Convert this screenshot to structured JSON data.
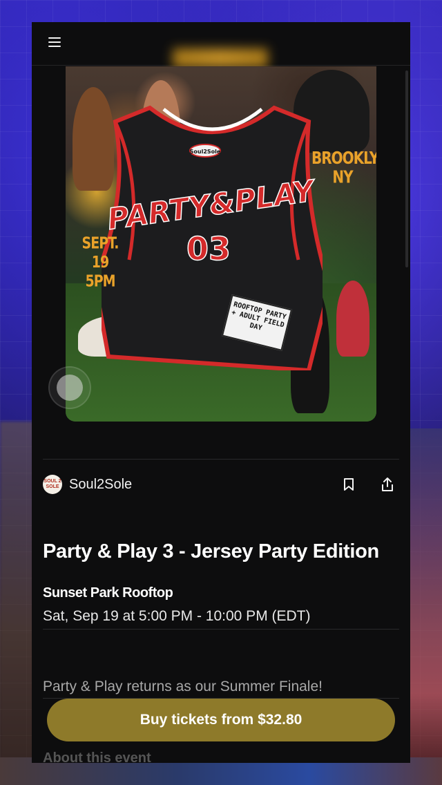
{
  "header": {
    "menu_icon": "hamburger-menu-icon"
  },
  "flyer": {
    "jersey_text": "PARTY&PLAY",
    "jersey_number": "03",
    "jersey_tag": "Soul2Sole",
    "brooklyn_text": "BROOKLYN, NY",
    "date_text": "SEPT. 19 5PM",
    "sign_text": "ROOFTOP PARTY + ADULT FIELD DAY"
  },
  "organizer": {
    "name": "Soul2Sole",
    "avatar_text": "SOUL 2 SOLE",
    "bookmark_icon": "bookmark-icon",
    "share_icon": "share-icon"
  },
  "event": {
    "title": "Party & Play 3 - Jersey Party Edition",
    "venue": "Sunset Park Rooftop",
    "datetime": "Sat, Sep 19 at 5:00 PM - 10:00 PM (EDT)",
    "summary": "Party & Play returns as our Summer Finale!",
    "about_heading": "About this event"
  },
  "cta": {
    "buy_label": "Buy tickets from $32.80"
  },
  "colors": {
    "panel_bg": "#0d0d0e",
    "cta_bg": "#8e7a2a",
    "flyer_accent": "#e9a22a",
    "jersey_red": "#d42a2a"
  }
}
